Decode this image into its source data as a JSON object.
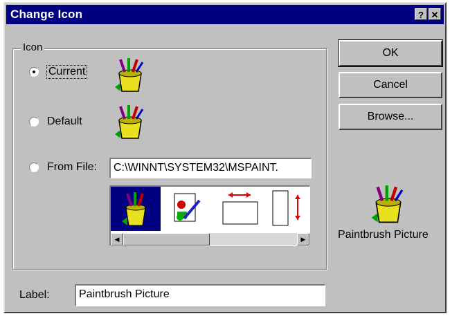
{
  "window": {
    "title": "Change Icon",
    "help_label": "?",
    "close_label": "✕"
  },
  "buttons": {
    "ok": "OK",
    "cancel": "Cancel",
    "browse": "Browse..."
  },
  "icon_group": {
    "label": "Icon",
    "options": [
      {
        "label": "Current",
        "selected": true
      },
      {
        "label": "Default",
        "selected": false
      },
      {
        "label": "From File:",
        "selected": false
      }
    ],
    "from_file_value": "C:\\WINNT\\SYSTEM32\\MSPAINT.",
    "icon_list": [
      "paintbrush-icon",
      "document-pen-icon",
      "horizontal-resize-icon",
      "vertical-resize-icon"
    ]
  },
  "preview": {
    "caption": "Paintbrush Picture"
  },
  "label_field": {
    "label": "Label:",
    "value": "Paintbrush Picture"
  }
}
